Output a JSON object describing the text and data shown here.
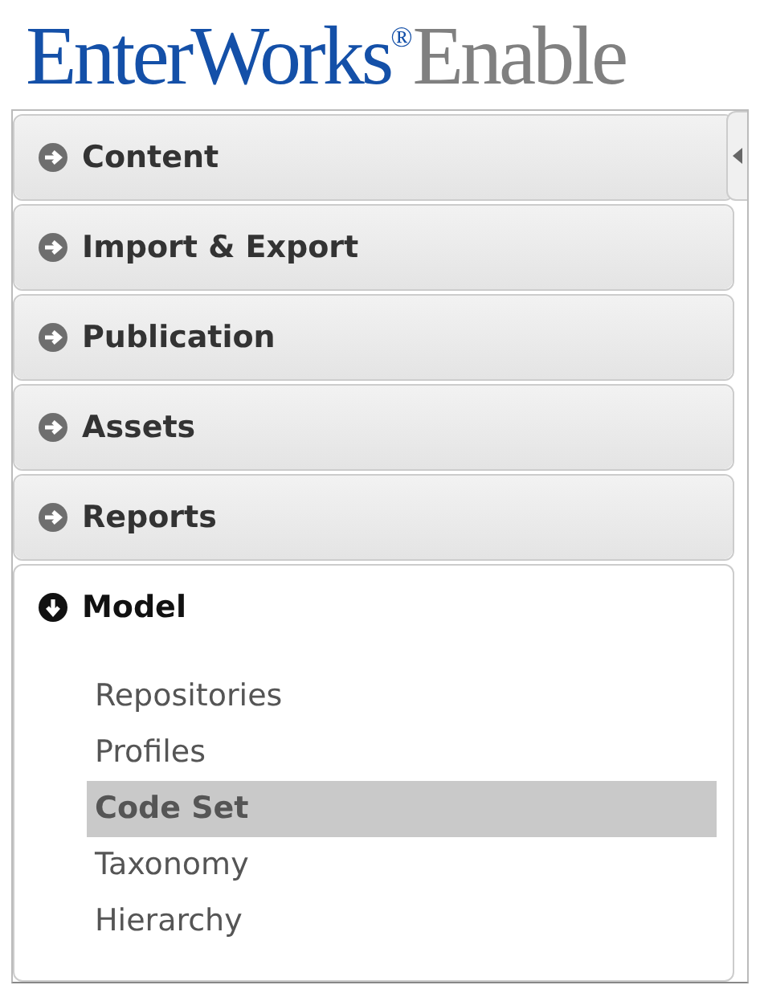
{
  "logo": {
    "brand": "EnterWorks",
    "mark": "®",
    "product": "Enable"
  },
  "sections": [
    {
      "title": "Content",
      "expanded": false
    },
    {
      "title": "Import & Export",
      "expanded": false
    },
    {
      "title": "Publication",
      "expanded": false
    },
    {
      "title": "Assets",
      "expanded": false
    },
    {
      "title": "Reports",
      "expanded": false
    },
    {
      "title": "Model",
      "expanded": true,
      "items": [
        {
          "label": "Repositories",
          "selected": false
        },
        {
          "label": "Profiles",
          "selected": false
        },
        {
          "label": "Code Set",
          "selected": true
        },
        {
          "label": "Taxonomy",
          "selected": false
        },
        {
          "label": "Hierarchy",
          "selected": false
        }
      ]
    }
  ]
}
